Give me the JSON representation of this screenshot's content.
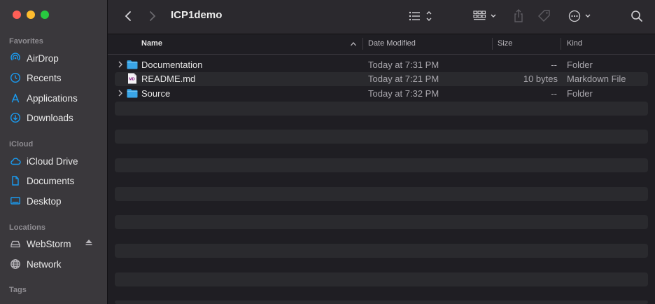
{
  "sidebar": {
    "sections": {
      "favorites": "Favorites",
      "icloud": "iCloud",
      "locations": "Locations",
      "tags": "Tags"
    },
    "items": [
      {
        "label": "AirDrop",
        "icon": "airdrop-icon"
      },
      {
        "label": "Recents",
        "icon": "clock-icon"
      },
      {
        "label": "Applications",
        "icon": "applications-icon"
      },
      {
        "label": "Downloads",
        "icon": "download-icon"
      },
      {
        "label": "iCloud Drive",
        "icon": "cloud-icon"
      },
      {
        "label": "Documents",
        "icon": "document-icon"
      },
      {
        "label": "Desktop",
        "icon": "desktop-icon"
      },
      {
        "label": "WebStorm",
        "icon": "drive-icon"
      },
      {
        "label": "Network",
        "icon": "globe-icon"
      }
    ]
  },
  "toolbar": {
    "title": "ICP1demo"
  },
  "columns": {
    "name": "Name",
    "date": "Date Modified",
    "size": "Size",
    "kind": "Kind"
  },
  "files": [
    {
      "name": "Documentation",
      "date": "Today at 7:31 PM",
      "size": "--",
      "kind": "Folder"
    },
    {
      "name": "README.md",
      "date": "Today at 7:21 PM",
      "size": "10 bytes",
      "kind": "Markdown File"
    },
    {
      "name": "Source",
      "date": "Today at 7:32 PM",
      "size": "--",
      "kind": "Folder"
    }
  ],
  "colors": {
    "accent": "#1a9bf0",
    "folder": "#3aa6e8"
  }
}
